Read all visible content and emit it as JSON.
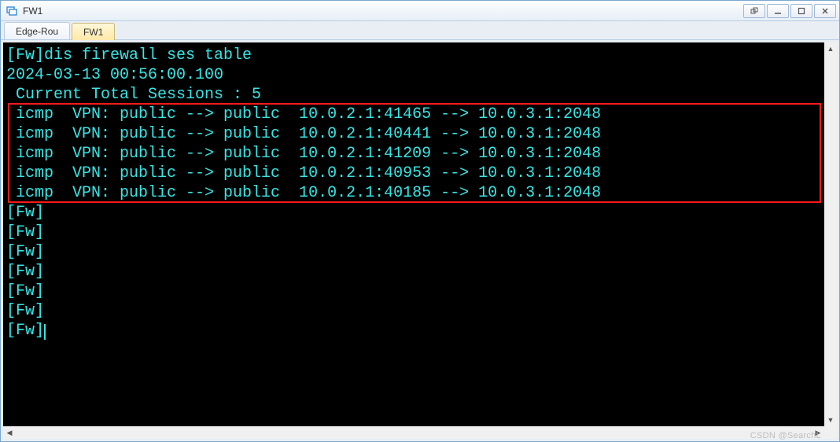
{
  "window": {
    "title": "FW1"
  },
  "tabs": [
    {
      "label": "Edge-Rou",
      "active": false
    },
    {
      "label": "FW1",
      "active": true
    }
  ],
  "terminal": {
    "prompt": "[Fw]",
    "command": "dis firewall ses table",
    "timestamp": "2024-03-13 00:56:00.100",
    "summary_line": " Current Total Sessions : 5",
    "sessions": [
      {
        "proto": "icmp",
        "vpn_from": "public",
        "vpn_to": "public",
        "src": "10.0.2.1:41465",
        "dst": "10.0.3.1:2048"
      },
      {
        "proto": "icmp",
        "vpn_from": "public",
        "vpn_to": "public",
        "src": "10.0.2.1:40441",
        "dst": "10.0.3.1:2048"
      },
      {
        "proto": "icmp",
        "vpn_from": "public",
        "vpn_to": "public",
        "src": "10.0.2.1:41209",
        "dst": "10.0.3.1:2048"
      },
      {
        "proto": "icmp",
        "vpn_from": "public",
        "vpn_to": "public",
        "src": "10.0.2.1:40953",
        "dst": "10.0.3.1:2048"
      },
      {
        "proto": "icmp",
        "vpn_from": "public",
        "vpn_to": "public",
        "src": "10.0.2.1:40185",
        "dst": "10.0.3.1:2048"
      }
    ],
    "trailing_prompts": 7
  },
  "watermark": "CSDN @SearchL"
}
